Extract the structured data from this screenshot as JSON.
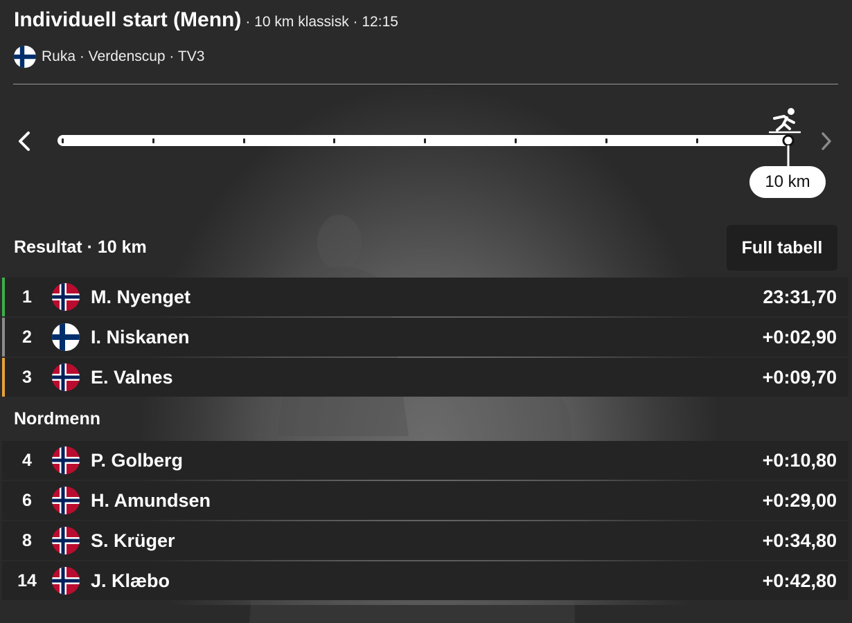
{
  "event": {
    "title": "Individuell start (Menn)",
    "meta": "· 10 km klassisk · 12:15",
    "venue": "Ruka · Verdenscup · TV3",
    "venue_flag": "fin"
  },
  "progress": {
    "label": "10 km",
    "current_km": 10,
    "total_km": 10,
    "prev_icon": "chevron-left-icon",
    "next_icon": "chevron-right-icon",
    "skier_icon": "cross-country-skier-icon"
  },
  "results": {
    "title": "Resultat · 10 km",
    "full_table_label": "Full tabell",
    "rows": [
      {
        "rank": "1",
        "flag": "nor",
        "name": "M. Nyenget",
        "time": "23:31,70",
        "medal_color": "#3cb04a"
      },
      {
        "rank": "2",
        "flag": "fin",
        "name": "I. Niskanen",
        "time": "+0:02,90",
        "medal_color": "#8c8c8c"
      },
      {
        "rank": "3",
        "flag": "nor",
        "name": "E. Valnes",
        "time": "+0:09,70",
        "medal_color": "#e8a23a"
      }
    ]
  },
  "norwegians": {
    "title": "Nordmenn",
    "rows": [
      {
        "rank": "4",
        "flag": "nor",
        "name": "P. Golberg",
        "time": "+0:10,80"
      },
      {
        "rank": "6",
        "flag": "nor",
        "name": "H. Amundsen",
        "time": "+0:29,00"
      },
      {
        "rank": "8",
        "flag": "nor",
        "name": "S. Krüger",
        "time": "+0:34,80"
      },
      {
        "rank": "14",
        "flag": "nor",
        "name": "J. Klæbo",
        "time": "+0:42,80"
      }
    ]
  },
  "colors": {
    "row_bg": "#242424",
    "norway_red": "#ba0c2f",
    "norway_blue": "#00205b",
    "finland_blue": "#002f6c"
  }
}
